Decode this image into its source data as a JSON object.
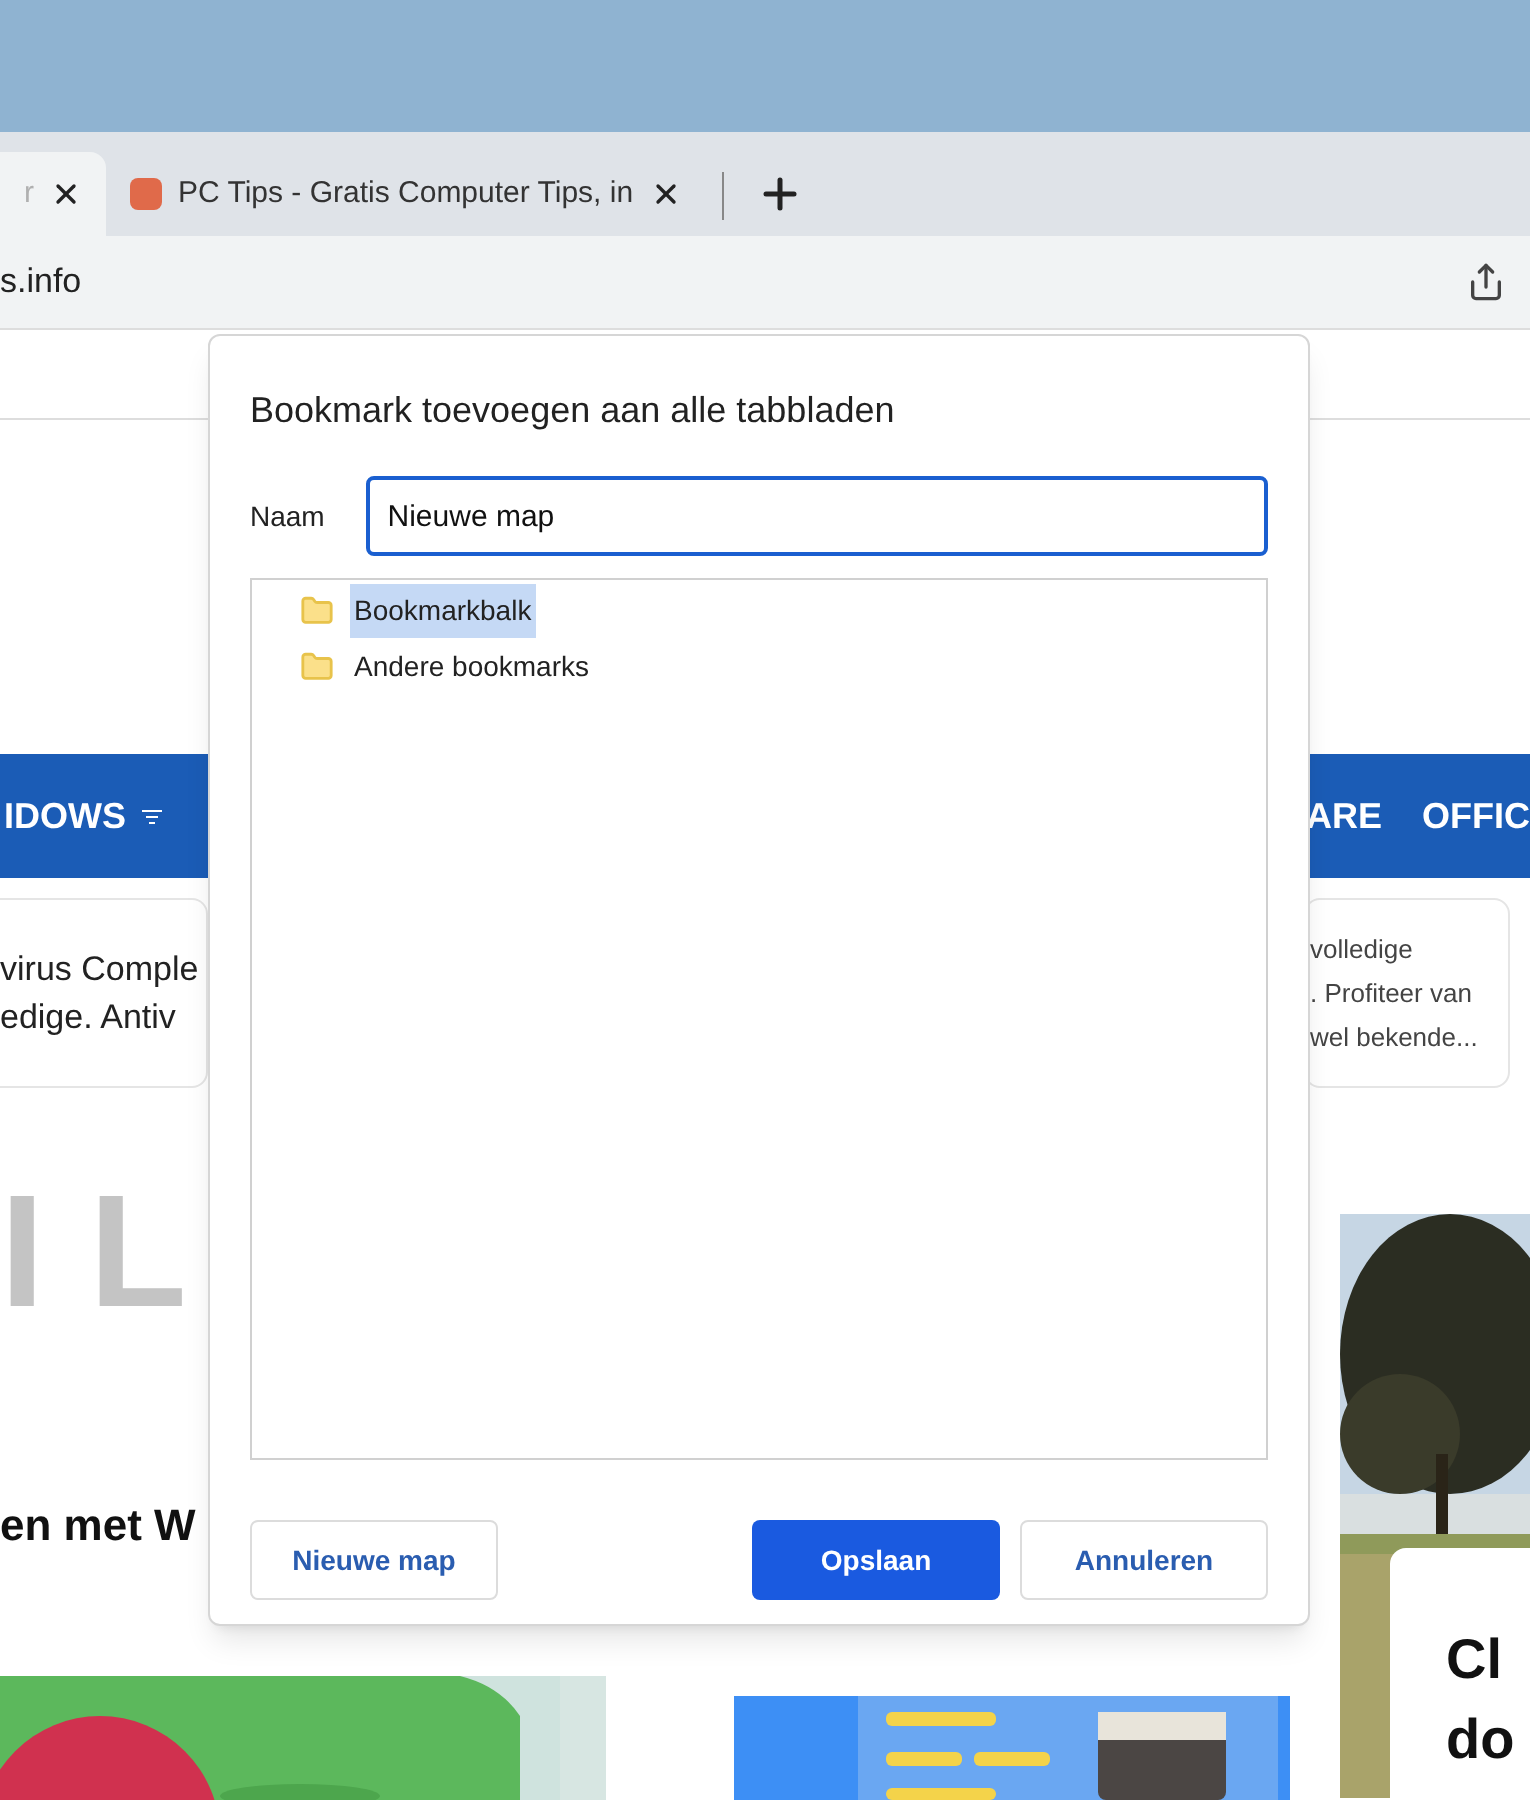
{
  "browser": {
    "tabs": [
      {
        "title": "r",
        "selected": true
      },
      {
        "title": "PC Tips - Gratis Computer Tips, in",
        "selected": false
      }
    ],
    "address": "s.info"
  },
  "page": {
    "nav_left": "IDOWS",
    "nav_right": [
      "ARE",
      "OFFIC"
    ],
    "card_left": [
      "virus Comple",
      "edige. Antiv"
    ],
    "card_right": [
      "volledige",
      ". Profiteer van",
      "wel bekende..."
    ],
    "big_letters": "I L",
    "heading": "en met W",
    "side_card": [
      "Cl",
      "do"
    ]
  },
  "dialog": {
    "title": "Bookmark toevoegen aan alle tabbladen",
    "name_label": "Naam",
    "name_value": "Nieuwe map",
    "folders": [
      {
        "label": "Bookmarkbalk",
        "selected": true
      },
      {
        "label": "Andere bookmarks",
        "selected": false
      }
    ],
    "buttons": [
      {
        "label": "Nieuwe map",
        "kind": "secondary"
      },
      {
        "label": "Opslaan",
        "kind": "primary"
      },
      {
        "label": "Annuleren",
        "kind": "secondary"
      }
    ]
  }
}
